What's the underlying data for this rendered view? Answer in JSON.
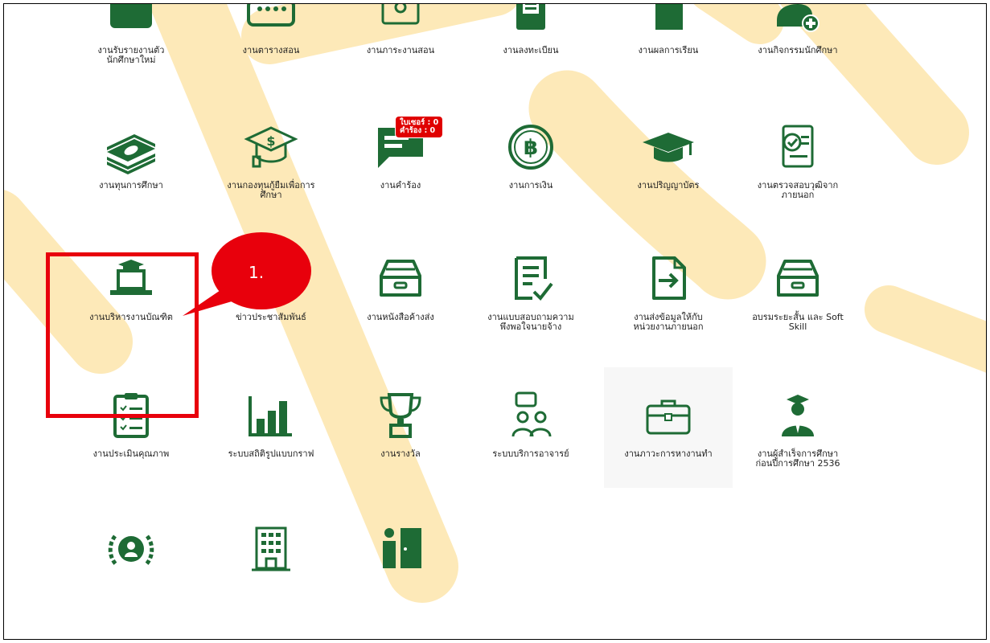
{
  "colors": {
    "icon": "#1e6b35",
    "badge": "#e00000",
    "highlight": "#e8000c",
    "watermark": "#fde9b8"
  },
  "tiles_row1": [
    {
      "label": "งานรับรายงานตัว\nนักศึกษาใหม่",
      "icon": "id-card-icon"
    },
    {
      "label": "งานตารางสอน",
      "icon": "keyboard-icon"
    },
    {
      "label": "งานภาระงานสอน",
      "icon": "teacher-icon"
    },
    {
      "label": "งานลงทะเบียน",
      "icon": "register-icon"
    },
    {
      "label": "งานผลการเรียน",
      "icon": "document-icon"
    },
    {
      "label": "งานกิจกรรมนักศึกษา",
      "icon": "group-add-icon"
    }
  ],
  "tiles_row2": [
    {
      "label": "งานทุนการศึกษา",
      "icon": "money-stack-icon"
    },
    {
      "label": "งานกองทุนกู้ยืมเพื่อการ\nศึกษา",
      "icon": "loan-cap-icon"
    },
    {
      "label": "งานคำร้อง",
      "icon": "message-icon",
      "badge": "ใบเซอร์ : 0\nคำร้อง : 0"
    },
    {
      "label": "งานการเงิน",
      "icon": "baht-coin-icon"
    },
    {
      "label": "งานปริญญาบัตร",
      "icon": "graduation-cap-icon"
    },
    {
      "label": "งานตรวจสอบวุฒิจาก\nภายนอก",
      "icon": "certificate-check-icon"
    }
  ],
  "tiles_row3": [
    {
      "label": "งานบริหารงานบัณฑิต",
      "icon": "laptop-cap-icon"
    },
    {
      "label": "ข่าวประชาสัมพันธ์",
      "icon": "news-icon"
    },
    {
      "label": "งานหนังสือค้างส่ง",
      "icon": "inbox-tray-icon"
    },
    {
      "label": "งานแบบสอบถามความ\nพึงพอใจนายจ้าง",
      "icon": "survey-check-icon"
    },
    {
      "label": "งานส่งข้อมูลให้กับ\nหน่วยงานภายนอก",
      "icon": "file-export-icon"
    },
    {
      "label": "อบรมระยะสั้น และ Soft\nSkill",
      "icon": "inbox-tray-icon"
    }
  ],
  "tiles_row4": [
    {
      "label": "งานประเมินคุณภาพ",
      "icon": "clipboard-list-icon"
    },
    {
      "label": "ระบบสถิติรูปแบบกราฟ",
      "icon": "bar-chart-icon"
    },
    {
      "label": "งานรางวัล",
      "icon": "trophy-icon"
    },
    {
      "label": "ระบบบริการอาจารย์",
      "icon": "consultation-icon"
    },
    {
      "label": "งานภาวะการหางานทำ",
      "icon": "briefcase-icon"
    },
    {
      "label": "งานผู้สำเร็จการศึกษา\nก่อนปีการศึกษา 2536",
      "icon": "graduate-person-icon"
    }
  ],
  "tiles_row5": [
    {
      "label": "",
      "icon": "laurel-group-icon"
    },
    {
      "label": "",
      "icon": "building-icon"
    },
    {
      "label": "",
      "icon": "person-door-icon"
    }
  ],
  "annotation": {
    "step_label": "1."
  }
}
